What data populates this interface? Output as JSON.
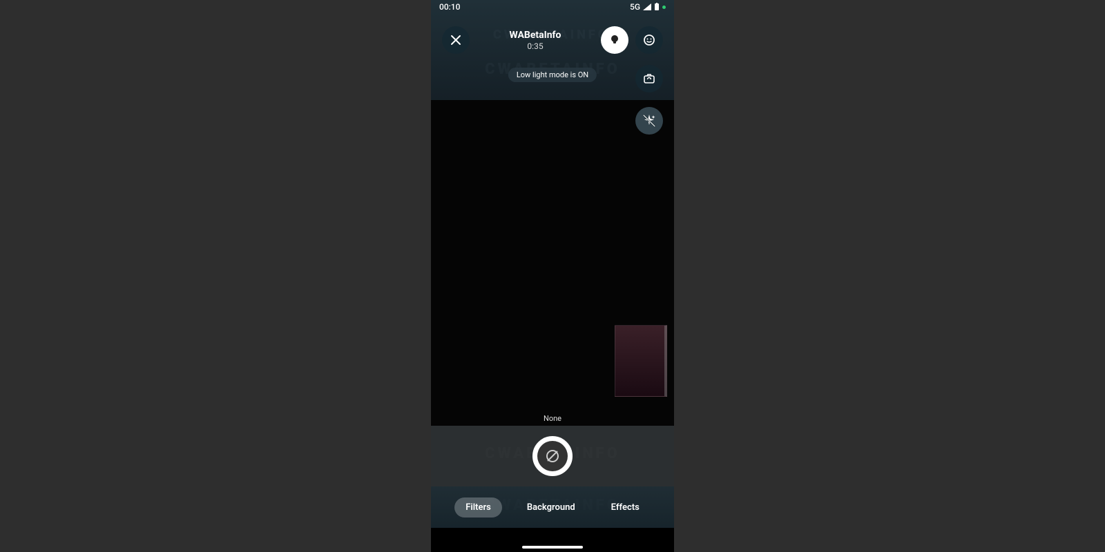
{
  "status": {
    "time": "00:10",
    "network": "5G"
  },
  "header": {
    "title": "WABetaInfo",
    "duration": "0:35"
  },
  "toast": {
    "text": "Low light mode is ON"
  },
  "video": {
    "filter_label": "None"
  },
  "tabs": {
    "items": [
      {
        "label": "Filters",
        "active": true
      },
      {
        "label": "Background",
        "active": false
      },
      {
        "label": "Effects",
        "active": false
      }
    ]
  },
  "watermark": "CWABETAINFO"
}
